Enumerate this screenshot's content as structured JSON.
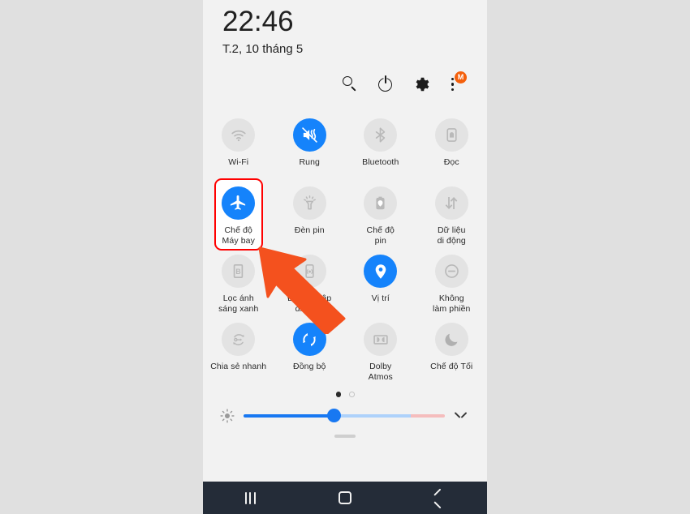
{
  "colors": {
    "page_background": "#e0e0e0",
    "panel_background": "#f2f2f2",
    "tile_active": "#1583fb",
    "tile_inactive": "#e3e3e3",
    "highlight_box": "#ff0000",
    "pointer_arrow": "#f4511e",
    "badge": "#f4600c",
    "navbar": "#242c38",
    "slider_filled": "#1878f2",
    "slider_mid": "#aed2fb",
    "slider_warm": "#f5bdbd"
  },
  "status": {
    "time": "22:46",
    "date": "T.2, 10 tháng 5"
  },
  "header_icons": [
    {
      "name": "search-icon",
      "label": "search"
    },
    {
      "name": "power-icon",
      "label": "power"
    },
    {
      "name": "settings-gear-icon",
      "label": "settings"
    },
    {
      "name": "more-options-icon",
      "label": "more",
      "badge": "M"
    }
  ],
  "tiles": [
    {
      "label": "Wi-Fi",
      "icon": "wifi-icon",
      "active": false,
      "highlighted": false
    },
    {
      "label": "Rung",
      "icon": "vibrate-icon",
      "active": true,
      "highlighted": false
    },
    {
      "label": "Bluetooth",
      "icon": "bluetooth-icon",
      "active": false,
      "highlighted": false
    },
    {
      "label": "Đọc",
      "icon": "nfc-read-icon",
      "active": false,
      "highlighted": false
    },
    {
      "label": "Chế độ\nMáy bay",
      "icon": "airplane-icon",
      "active": true,
      "highlighted": true
    },
    {
      "label": "Đèn pin",
      "icon": "flashlight-icon",
      "active": false,
      "highlighted": false
    },
    {
      "label": "Chế độ\npin",
      "icon": "power-saving-icon",
      "active": false,
      "highlighted": false
    },
    {
      "label": "Dữ liệu\ndi động",
      "icon": "mobile-data-icon",
      "active": false,
      "highlighted": false
    },
    {
      "label": "Lọc ánh\nsáng xanh",
      "icon": "blue-light-filter-icon",
      "active": false,
      "highlighted": false
    },
    {
      "label": "Điểm tr.cập\ndi động",
      "icon": "hotspot-icon",
      "active": false,
      "highlighted": false
    },
    {
      "label": "Vị trí",
      "icon": "location-pin-icon",
      "active": true,
      "highlighted": false
    },
    {
      "label": "Không\nlàm phiền",
      "icon": "do-not-disturb-icon",
      "active": false,
      "highlighted": false
    },
    {
      "label": "Chia sẻ nhanh",
      "icon": "quick-share-icon",
      "active": false,
      "highlighted": false
    },
    {
      "label": "Đồng bộ",
      "icon": "sync-icon",
      "active": true,
      "highlighted": false
    },
    {
      "label": "Dolby\nAtmos",
      "icon": "dolby-atmos-icon",
      "active": false,
      "highlighted": false
    },
    {
      "label": "Chế độ Tối",
      "icon": "dark-mode-moon-icon",
      "active": false,
      "highlighted": false
    }
  ],
  "pager": {
    "total": 2,
    "current": 1
  },
  "brightness": {
    "icon": "brightness-icon",
    "value_percent": 45,
    "expand_icon": "chevron-down-icon"
  },
  "navbar": [
    {
      "name": "recents-button",
      "icon": "recents-icon"
    },
    {
      "name": "home-button",
      "icon": "home-icon"
    },
    {
      "name": "back-button",
      "icon": "back-icon"
    }
  ],
  "annotation": {
    "pointer": "arrow-pointer",
    "target": "Chế độ Máy bay"
  }
}
